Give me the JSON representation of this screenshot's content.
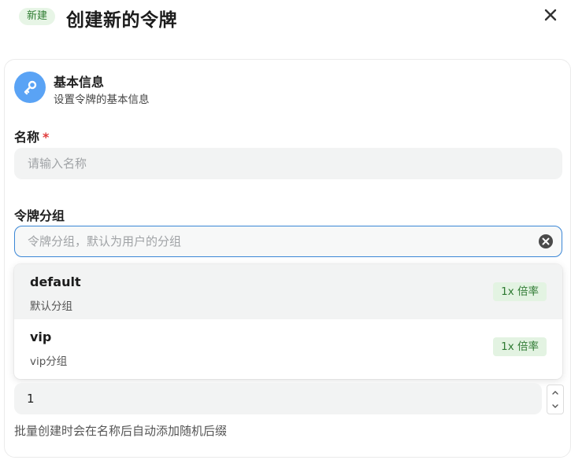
{
  "header": {
    "badge": "新建",
    "title": "创建新的令牌"
  },
  "section": {
    "title": "基本信息",
    "subtitle": "设置令牌的基本信息"
  },
  "name_field": {
    "label": "名称",
    "required_mark": "*",
    "placeholder": "请输入名称"
  },
  "group_field": {
    "label": "令牌分组",
    "placeholder": "令牌分组，默认为用户的分组"
  },
  "group_options": [
    {
      "name": "default",
      "description": "默认分组",
      "rate": "1x 倍率"
    },
    {
      "name": "vip",
      "description": "vip分组",
      "rate": "1x 倍率"
    }
  ],
  "quantity_field": {
    "value": "1",
    "helper": "批量创建时会在名称后自动添加随机后缀"
  },
  "colors": {
    "accent": "#3a86d6",
    "required": "#e03b3b",
    "badge_bg": "#e7f5e6",
    "badge_text": "#2f7d32",
    "icon_bg": "#5aa3f5"
  }
}
